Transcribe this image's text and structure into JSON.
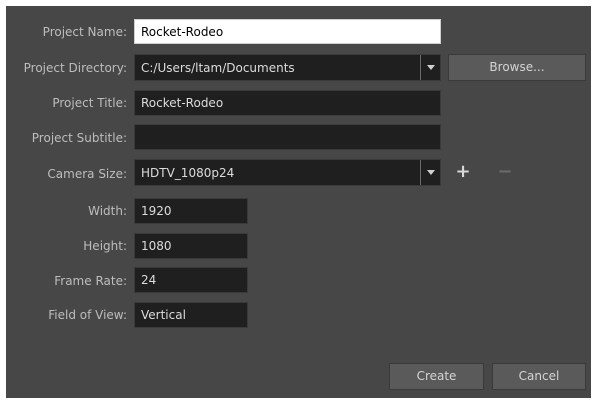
{
  "form": {
    "project_name": {
      "label": "Project Name:",
      "value": "Rocket-Rodeo"
    },
    "project_directory": {
      "label": "Project Directory:",
      "value": "C:/Users/ltam/Documents"
    },
    "browse_label": "Browse...",
    "project_title": {
      "label": "Project Title:",
      "value": "Rocket-Rodeo"
    },
    "project_subtitle": {
      "label": "Project Subtitle:",
      "value": ""
    },
    "camera_size": {
      "label": "Camera Size:",
      "value": "HDTV_1080p24"
    },
    "add_symbol": "+",
    "remove_symbol": "−",
    "width": {
      "label": "Width:",
      "value": "1920"
    },
    "height": {
      "label": "Height:",
      "value": "1080"
    },
    "frame_rate": {
      "label": "Frame Rate:",
      "value": "24"
    },
    "field_of_view": {
      "label": "Field of View:",
      "value": "Vertical"
    }
  },
  "buttons": {
    "create": "Create",
    "cancel": "Cancel"
  },
  "colors": {
    "dialog_background": "#474747",
    "field_background": "#1f1f1f",
    "button_background": "#5a5a5a"
  },
  "icons": {
    "dropdown": "chevron-down-icon",
    "add": "plus-icon",
    "remove": "minus-icon"
  }
}
